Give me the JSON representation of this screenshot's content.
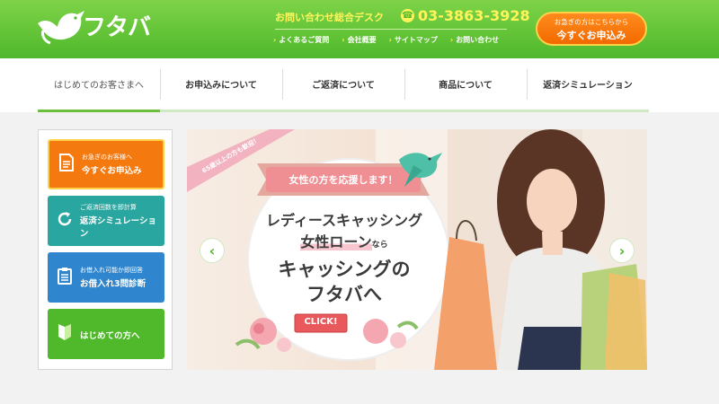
{
  "header": {
    "logo_text": "フタバ",
    "contact_label": "お問い合わせ総合デスク",
    "phone": "03-3863-3928",
    "sublinks": [
      "よくあるご質問",
      "会社概要",
      "サイトマップ",
      "お問い合わせ"
    ],
    "cta_small": "お急ぎの方はこちらから",
    "cta_big": "今すぐお申込み"
  },
  "nav": {
    "items": [
      "はじめてのお客さまへ",
      "お申込みについて",
      "ご返済について",
      "商品について",
      "返済シミュレーション"
    ]
  },
  "sidebar": {
    "buttons": [
      {
        "small": "お急ぎのお客様へ",
        "big": "今すぐお申込み",
        "icon": "document-icon",
        "color": "#f47a10"
      },
      {
        "small": "ご返済回数を即計算",
        "big": "返済シミュレーション",
        "icon": "refresh-icon",
        "color": "#2aa6a0"
      },
      {
        "small": "お借入れ可能か即回答",
        "big": "お借入れ3問診断",
        "icon": "clipboard-icon",
        "color": "#2f86cf"
      },
      {
        "small": "",
        "big": "はじめての方へ",
        "icon": "beginner-mark-icon",
        "color": "#4fb82b"
      }
    ]
  },
  "banner": {
    "corner_badge": "65歳以上の方も歓迎！",
    "ribbon": "女性の方を応援します！",
    "line1": "レディースキャッシング",
    "line2_main": "女性ローン",
    "line2_suffix": "なら",
    "line3": "キャッシングの",
    "line4": "フタバへ",
    "click_label": "CLICK!",
    "prev_icon": "chevron-left-icon",
    "next_icon": "chevron-right-icon"
  },
  "colors": {
    "brand_green": "#4fb82b",
    "accent_yellow": "#fff55a",
    "cta_orange": "#f47a10"
  }
}
